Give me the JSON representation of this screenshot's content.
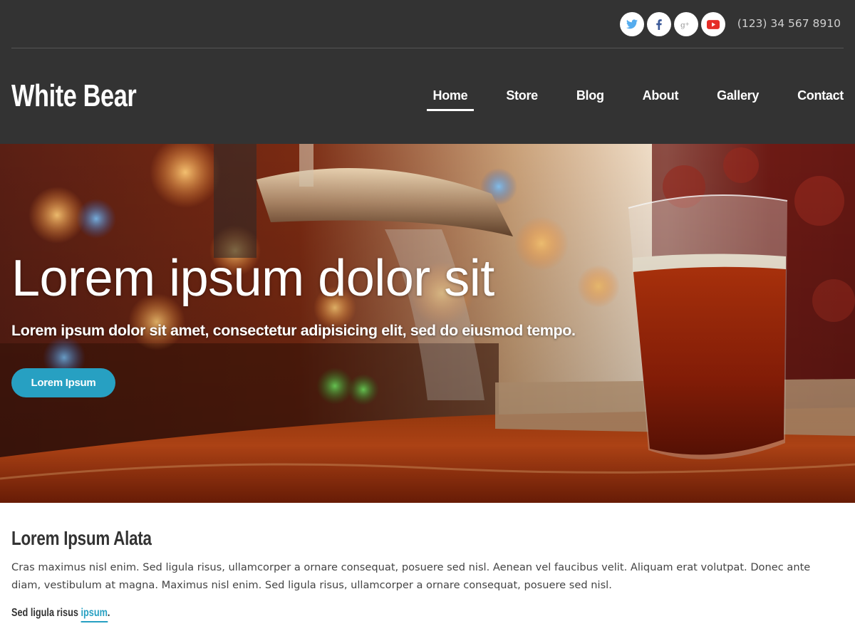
{
  "header": {
    "phone": "(123) 34 567 8910",
    "social_icons": [
      "twitter-icon",
      "facebook-icon",
      "google-plus-icon",
      "youtube-icon"
    ],
    "brand": "White Bear",
    "nav": [
      {
        "label": "Home",
        "active": true
      },
      {
        "label": "Store",
        "active": false
      },
      {
        "label": "Blog",
        "active": false
      },
      {
        "label": "About",
        "active": false
      },
      {
        "label": "Gallery",
        "active": false
      },
      {
        "label": "Contact",
        "active": false
      }
    ]
  },
  "hero": {
    "title": "Lorem ipsum dolor sit",
    "subtitle": "Lorem ipsum dolor sit amet, consectetur adipisicing elit, sed do eiusmod tempo.",
    "button_label": "Lorem Ipsum"
  },
  "section": {
    "title": "Lorem Ipsum Alata",
    "body": "Cras maximus nisl enim. Sed ligula risus, ullamcorper a ornare consequat, posuere sed nisl. Aenean vel faucibus velit. Aliquam erat volutpat. Donec ante diam, vestibulum at magna. Maximus nisl enim. Sed ligula risus, ullamcorper a ornare consequat, posuere sed nisl.",
    "tagline_text": "Sed ligula risus",
    "tagline_link": "ipsum",
    "tagline_end": "."
  },
  "colors": {
    "header_bg": "#333333",
    "accent": "#27a0c2",
    "twitter": "#55acee",
    "facebook": "#3b5998",
    "google_plus": "#aaaaaa",
    "youtube": "#e52d27"
  }
}
